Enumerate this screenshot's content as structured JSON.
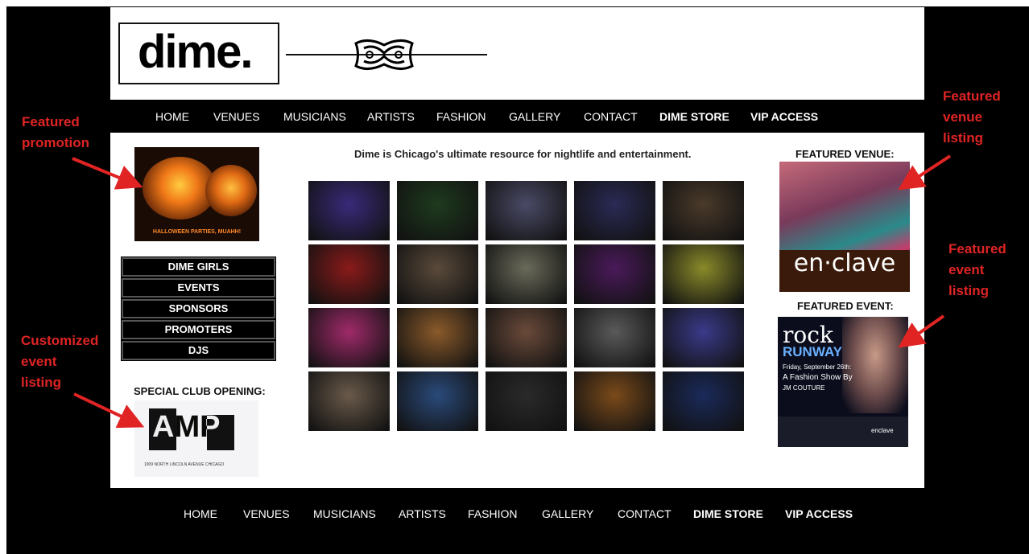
{
  "logo": {
    "text": "dime."
  },
  "nav": [
    {
      "label": "HOME",
      "bold": false
    },
    {
      "label": "VENUES",
      "bold": false
    },
    {
      "label": "MUSICIANS",
      "bold": false
    },
    {
      "label": "ARTISTS",
      "bold": false
    },
    {
      "label": "FASHION",
      "bold": false
    },
    {
      "label": "GALLERY",
      "bold": false
    },
    {
      "label": "CONTACT",
      "bold": false
    },
    {
      "label": "DIME STORE",
      "bold": true
    },
    {
      "label": "VIP ACCESS",
      "bold": true
    }
  ],
  "promo": {
    "caption": "HALLOWEEN PARTIES, MUAHH!"
  },
  "menu": [
    "DIME GIRLS",
    "EVENTS",
    "SPONSORS",
    "PROMOTERS",
    "DJS"
  ],
  "special": {
    "title": "SPECIAL CLUB OPENING:",
    "logo": "AMP",
    "address": "1909 NORTH LINCOLN AVENUE CHICAGO"
  },
  "tagline": "Dime is Chicago's ultimate resource for nightlife and entertainment.",
  "gallery_colors": [
    [
      "#3a2a7a",
      "#1e3a1e",
      "#4a4a66",
      "#2a2a55",
      "#4a3a2a"
    ],
    [
      "#8a1a1a",
      "#5a4a3a",
      "#6a6a5a",
      "#4a1a5a",
      "#8a8a2a"
    ],
    [
      "#a02a6a",
      "#8a5a2a",
      "#6a4a3a",
      "#5a5a5a",
      "#3a3a8a"
    ],
    [
      "#6a5a4a",
      "#2a4a7a",
      "#2a2a2a",
      "#7a4a1a",
      "#1a2a5a"
    ]
  ],
  "featured_venue": {
    "title": "FEATURED VENUE:",
    "name": "en·clave"
  },
  "featured_event": {
    "title": "FEATURED EVENT:",
    "line1": "rock",
    "line2": "RUNWAY",
    "line3": "Friday, September 26th:",
    "line4": "A Fashion Show By",
    "line5": "JM COUTURE",
    "footer": "enclave"
  },
  "annotations": {
    "featured_promotion": [
      "Featured",
      "promotion"
    ],
    "customized_event": [
      "Customized",
      "event",
      "listing"
    ],
    "featured_venue": [
      "Featured",
      "venue",
      "listing"
    ],
    "featured_event": [
      "Featured",
      "event",
      "listing"
    ]
  },
  "colors": {
    "annotation_red": "#e02424",
    "frame": "#000000"
  }
}
